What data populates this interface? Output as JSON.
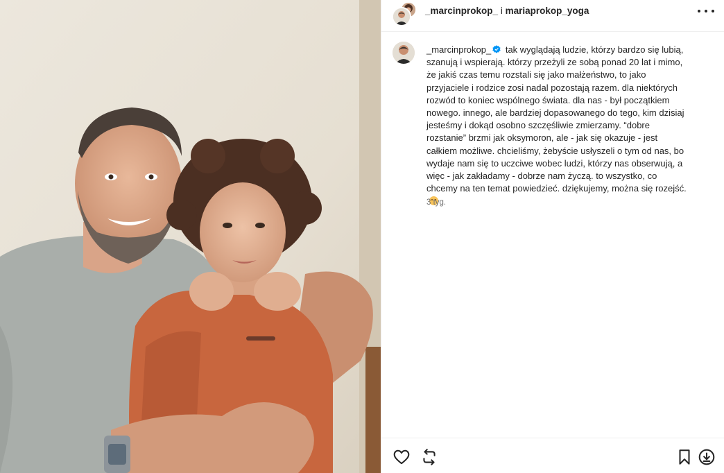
{
  "header": {
    "user_primary": "_marcinprokop_",
    "separator": "i",
    "user_secondary": "mariaprokop_yoga"
  },
  "caption": {
    "username": "_marcinprokop_",
    "text": "tak wyglądają ludzie, którzy bardzo się lubią, szanują i wspierają. którzy przeżyli ze sobą ponad 20 lat i mimo, że jakiś czas temu rozstali się jako małżeństwo, to jako przyjaciele i rodzice zosi nadal pozostają razem. dla niektórych rozwód to koniec wspólnego świata. dla nas - był początkiem nowego. innego, ale bardziej dopasowanego do tego, kim dzisiaj jesteśmy i dokąd osobno szczęśliwie zmierzamy. “dobre rozstanie” brzmi jak oksymoron, ale - jak się okazuje - jest całkiem możliwe. chcieliśmy, żebyście usłyszeli o tym od nas, bo wydaje nam się to uczciwe wobec ludzi, którzy nas obserwują, a więc - jak zakładamy - dobrze nam życzą. to wszystko, co chcemy na ten temat powiedzieć. dziękujemy, można się rozejść.",
    "timestamp": "3 tyg."
  },
  "icons": {
    "more": "more-options-icon",
    "verified": "verified-badge-icon",
    "like": "heart-icon",
    "repost": "repost-icon",
    "save": "bookmark-icon",
    "download": "download-icon",
    "emoji": "smiling-face-emoji"
  },
  "colors": {
    "verified": "#0095f6",
    "text": "#262626",
    "muted": "#737373",
    "divider": "#efefef"
  }
}
